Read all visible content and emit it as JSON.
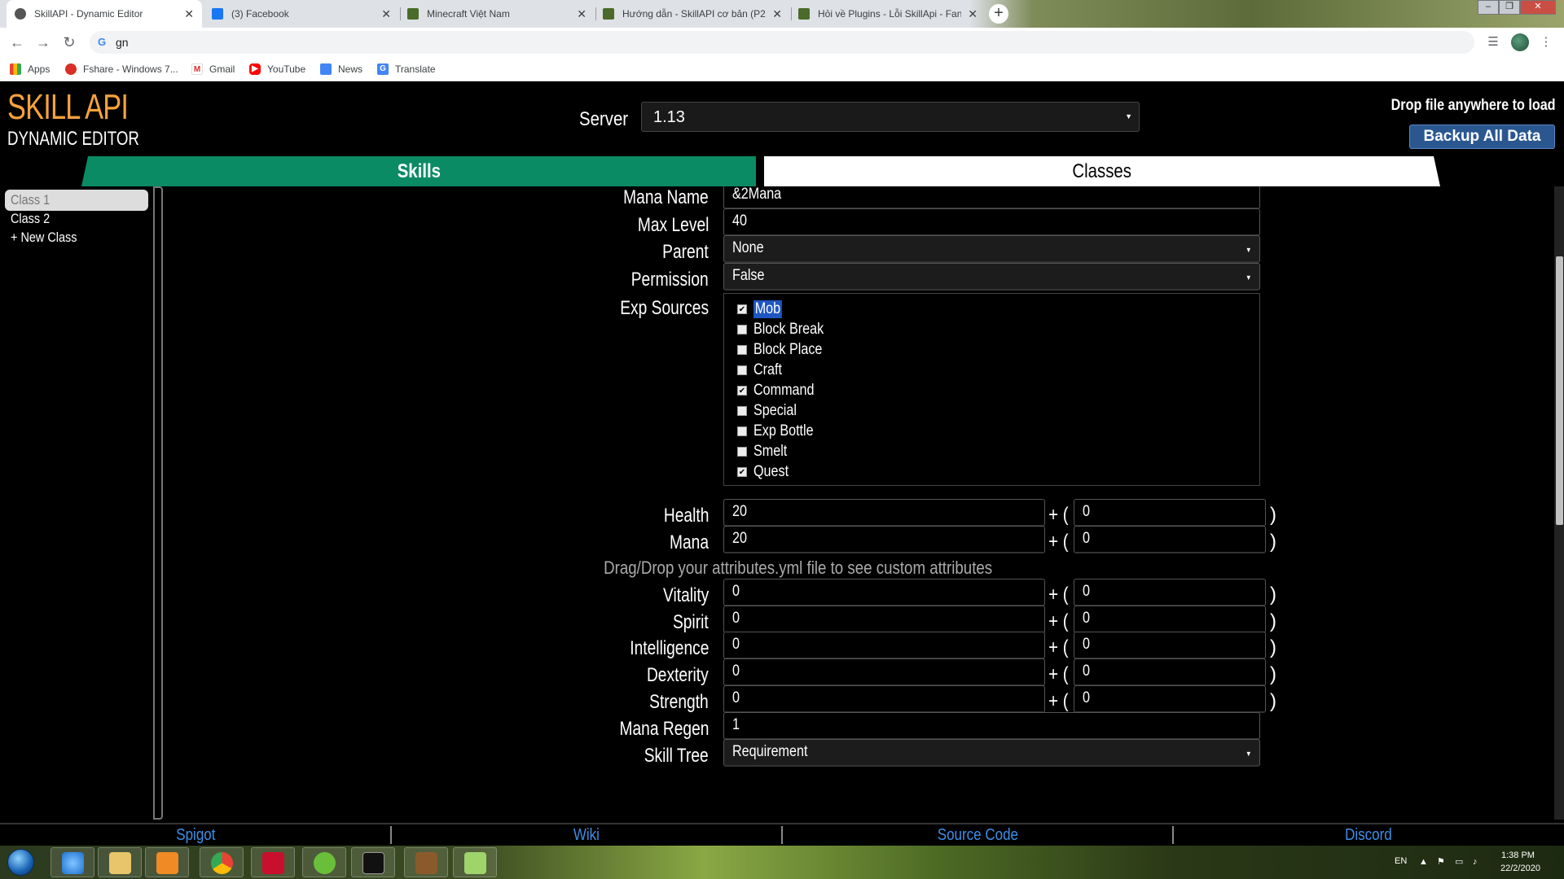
{
  "browser": {
    "tabs": [
      {
        "title": "SkillAPI - Dynamic Editor",
        "icon": "skillapi-favicon",
        "active": true
      },
      {
        "title": "(3) Facebook",
        "icon": "facebook-favicon",
        "active": false
      },
      {
        "title": "Minecraft Việt Nam",
        "icon": "minecraft-favicon",
        "active": false
      },
      {
        "title": "Hướng dẫn - SkillAPI cơ bản (P2)",
        "icon": "minecraft-favicon",
        "active": false
      },
      {
        "title": "Hỏi về Plugins - Lỗi SkillApi - Fan",
        "icon": "minecraft-favicon",
        "active": false
      }
    ],
    "address": "gn",
    "bookmarks": [
      "Apps",
      "Fshare - Windows 7...",
      "Gmail",
      "YouTube",
      "News",
      "Translate"
    ]
  },
  "app": {
    "logo_main": "SKILL API",
    "logo_sub": "DYNAMIC EDITOR",
    "server_label": "Server",
    "server_value": "1.13",
    "drop_note": "Drop file anywhere to load",
    "backup_label": "Backup All Data",
    "tabs": {
      "skills": "Skills",
      "classes": "Classes"
    },
    "accent_color": "#0a8b63",
    "brand_color": "#f7a23b"
  },
  "sidebar": {
    "classes": [
      "Class 1",
      "Class 2"
    ],
    "new_class": "+ New Class",
    "selected": "Class 1"
  },
  "form": {
    "mana_name": {
      "label": "Mana Name",
      "value": "&2Mana"
    },
    "max_level": {
      "label": "Max Level",
      "value": "40"
    },
    "parent": {
      "label": "Parent",
      "value": "None"
    },
    "permission": {
      "label": "Permission",
      "value": "False"
    },
    "exp_sources": {
      "label": "Exp Sources",
      "items": [
        {
          "name": "Mob",
          "checked": true
        },
        {
          "name": "Block Break",
          "checked": false
        },
        {
          "name": "Block Place",
          "checked": false
        },
        {
          "name": "Craft",
          "checked": false
        },
        {
          "name": "Command",
          "checked": true
        },
        {
          "name": "Special",
          "checked": false
        },
        {
          "name": "Exp Bottle",
          "checked": false
        },
        {
          "name": "Smelt",
          "checked": false
        },
        {
          "name": "Quest",
          "checked": true
        }
      ]
    },
    "health": {
      "label": "Health",
      "base": "20",
      "scale": "0"
    },
    "mana": {
      "label": "Mana",
      "base": "20",
      "scale": "0"
    },
    "attributes_note": "Drag/Drop your attributes.yml file to see custom attributes",
    "vitality": {
      "label": "Vitality",
      "base": "0",
      "scale": "0"
    },
    "spirit": {
      "label": "Spirit",
      "base": "0",
      "scale": "0"
    },
    "intelligence": {
      "label": "Intelligence",
      "base": "0",
      "scale": "0"
    },
    "dexterity": {
      "label": "Dexterity",
      "base": "0",
      "scale": "0"
    },
    "strength": {
      "label": "Strength",
      "base": "0",
      "scale": "0"
    },
    "mana_regen": {
      "label": "Mana Regen",
      "value": "1"
    },
    "skill_tree": {
      "label": "Skill Tree",
      "value": "Requirement"
    },
    "plus_paren": "+ (",
    "close_paren": ")"
  },
  "footer": {
    "links": [
      "Spigot",
      "Wiki",
      "Source Code",
      "Discord"
    ]
  },
  "taskbar": {
    "language": "EN",
    "time": "1:38 PM",
    "date": "22/2/2020"
  }
}
